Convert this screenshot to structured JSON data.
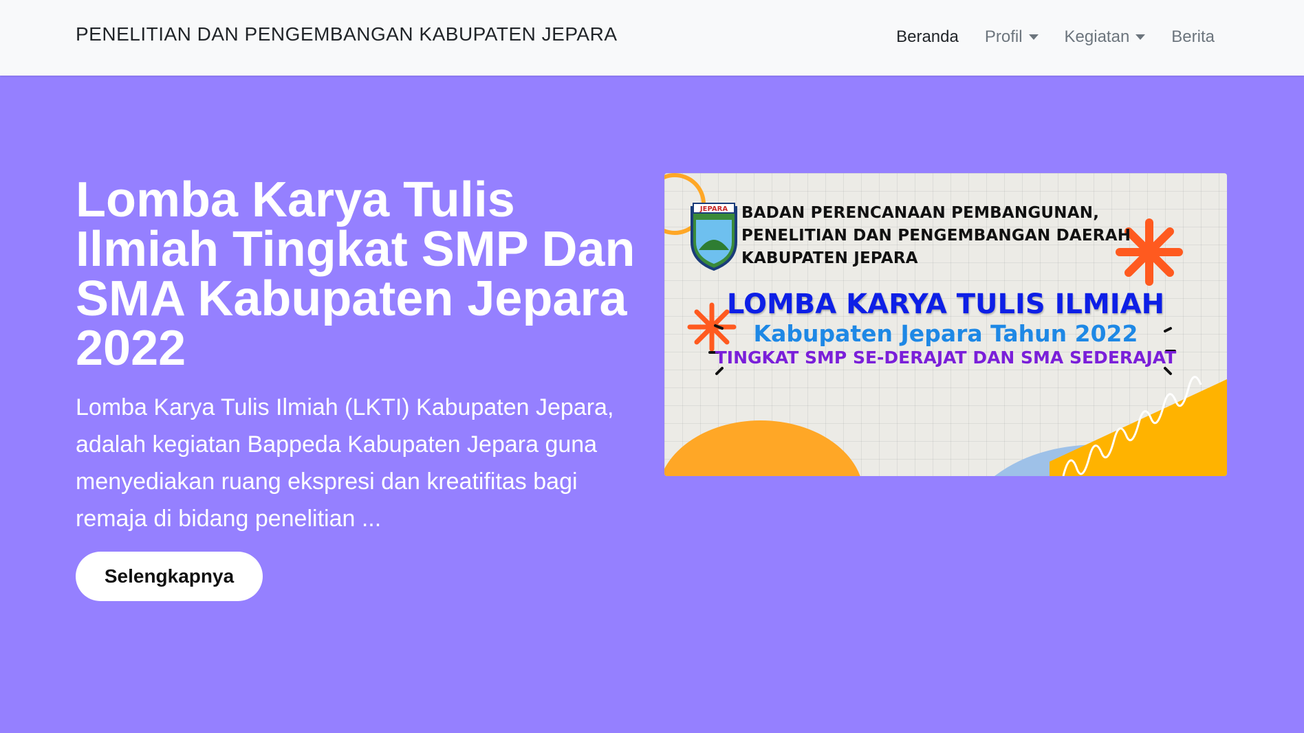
{
  "navbar": {
    "brand": "PENELITIAN DAN PENGEMBANGAN KABUPATEN JEPARA",
    "items": [
      {
        "label": "Beranda",
        "active": true,
        "dropdown": false
      },
      {
        "label": "Profil",
        "active": false,
        "dropdown": true
      },
      {
        "label": "Kegiatan",
        "active": false,
        "dropdown": true
      },
      {
        "label": "Berita",
        "active": false,
        "dropdown": false
      }
    ]
  },
  "hero": {
    "title": "Lomba Karya Tulis Ilmiah Tingkat SMP Dan SMA Kabupaten Jepara 2022",
    "description": "Lomba Karya Tulis Ilmiah (LKTI) Kabupaten Jepara, adalah kegiatan Bappeda Kabupaten Jepara guna menyediakan ruang ekspresi dan kreatifitas bagi remaja di bidang penelitian ...",
    "button_label": "Selengkapnya",
    "background_color": "#9580ff"
  },
  "banner": {
    "org_lines": [
      "BADAN PERENCANAAN PEMBANGUNAN,",
      "PENELITIAN DAN PENGEMBANGAN DAERAH",
      "KABUPATEN JEPARA"
    ],
    "crest_label": "JEPARA",
    "title": "LOMBA KARYA TULIS ILMIAH",
    "subtitle": "Kabupaten Jepara  Tahun 2022",
    "level": "TINGKAT SMP SE-DERAJAT DAN SMA SEDERAJAT",
    "colors": {
      "title": "#0d1fe6",
      "subtitle": "#1e88e5",
      "level": "#7a1fd9",
      "accent": "#ff5a1f",
      "yellow": "#ffa726"
    }
  }
}
